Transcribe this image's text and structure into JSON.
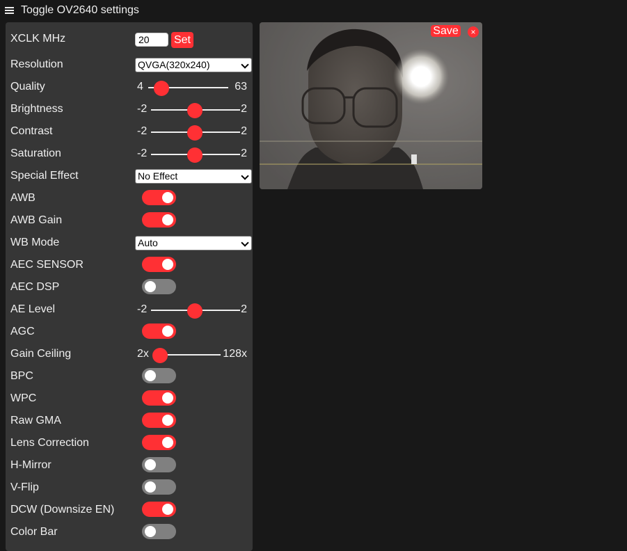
{
  "header": {
    "title": "Toggle OV2640 settings",
    "menu_icon": "hamburger-menu-icon"
  },
  "colors": {
    "accent": "#ff3034",
    "panel": "#363636",
    "background": "#181818",
    "toggle_off": "#808080"
  },
  "xclk": {
    "label": "XCLK MHz",
    "value": "20",
    "button": "Set"
  },
  "selects": {
    "resolution": {
      "label": "Resolution",
      "value": "QVGA(320x240)"
    },
    "special_effect": {
      "label": "Special Effect",
      "value": "No Effect"
    },
    "wb_mode": {
      "label": "WB Mode",
      "value": "Auto"
    }
  },
  "sliders": {
    "quality": {
      "label": "Quality",
      "min": "4",
      "max": "63",
      "value": 10
    },
    "brightness": {
      "label": "Brightness",
      "min": "-2",
      "max": "2",
      "value": 0
    },
    "contrast": {
      "label": "Contrast",
      "min": "-2",
      "max": "2",
      "value": 0
    },
    "saturation": {
      "label": "Saturation",
      "min": "-2",
      "max": "2",
      "value": 0
    },
    "ae_level": {
      "label": "AE Level",
      "min": "-2",
      "max": "2",
      "value": 0
    },
    "gain_ceiling": {
      "label": "Gain Ceiling",
      "min": "2x",
      "max": "128x",
      "value": 0
    }
  },
  "toggles": {
    "awb": {
      "label": "AWB",
      "on": true
    },
    "awb_gain": {
      "label": "AWB Gain",
      "on": true
    },
    "aec_sensor": {
      "label": "AEC SENSOR",
      "on": true
    },
    "aec_dsp": {
      "label": "AEC DSP",
      "on": false
    },
    "agc": {
      "label": "AGC",
      "on": true
    },
    "bpc": {
      "label": "BPC",
      "on": false
    },
    "wpc": {
      "label": "WPC",
      "on": true
    },
    "raw_gma": {
      "label": "Raw GMA",
      "on": true
    },
    "lens_correction": {
      "label": "Lens Correction",
      "on": true
    },
    "hmirror": {
      "label": "H-Mirror",
      "on": false
    },
    "vflip": {
      "label": "V-Flip",
      "on": false
    },
    "dcw": {
      "label": "DCW (Downsize EN)",
      "on": true
    },
    "colorbar": {
      "label": "Color Bar",
      "on": false
    }
  },
  "stream": {
    "save_label": "Save",
    "close_label": "×"
  }
}
